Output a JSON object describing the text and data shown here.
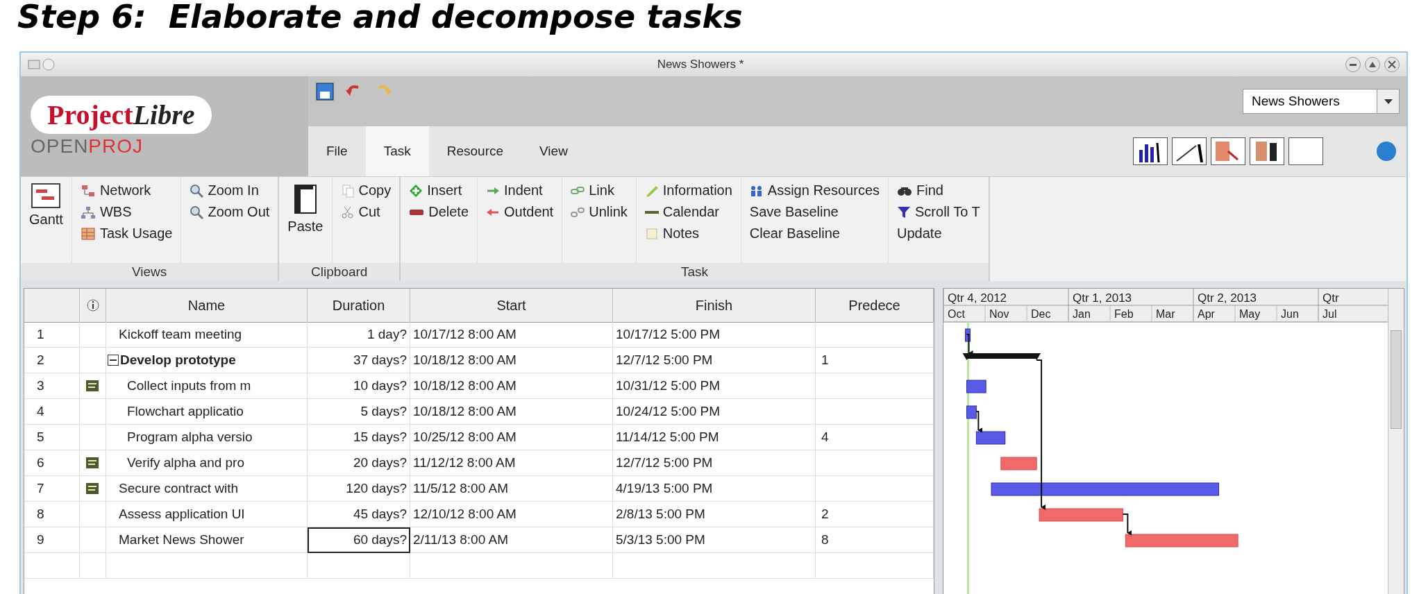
{
  "slide_title": "Step 6:  Elaborate and decompose tasks",
  "window": {
    "title": "News Showers *"
  },
  "logo": {
    "name_a": "Project",
    "name_b": "Libre",
    "sub_a": "OPEN",
    "sub_b": "PROJ"
  },
  "project_selector": {
    "value": "News Showers"
  },
  "menu_tabs": [
    {
      "label": "File",
      "selected": false
    },
    {
      "label": "Task",
      "selected": true
    },
    {
      "label": "Resource",
      "selected": false
    },
    {
      "label": "View",
      "selected": false
    }
  ],
  "ribbon_groups": [
    {
      "label": "Views",
      "sections": [
        [
          {
            "label": "Gantt",
            "kind": "large"
          }
        ],
        [
          {
            "label": "Network",
            "kind": "small"
          },
          {
            "label": "WBS",
            "kind": "small"
          },
          {
            "label": "Task Usage",
            "kind": "small"
          }
        ],
        [
          {
            "label": "Zoom In",
            "kind": "small"
          },
          {
            "label": "Zoom Out",
            "kind": "small"
          }
        ]
      ]
    },
    {
      "label": "Clipboard",
      "sections": [
        [
          {
            "label": "Paste",
            "kind": "large"
          }
        ],
        [
          {
            "label": "Copy",
            "kind": "small"
          },
          {
            "label": "Cut",
            "kind": "small"
          }
        ]
      ]
    },
    {
      "label": "Task",
      "sections": [
        [
          {
            "label": "Insert",
            "kind": "small"
          },
          {
            "label": "Delete",
            "kind": "small"
          }
        ],
        [
          {
            "label": "Indent",
            "kind": "small"
          },
          {
            "label": "Outdent",
            "kind": "small"
          }
        ],
        [
          {
            "label": "Link",
            "kind": "small"
          },
          {
            "label": "Unlink",
            "kind": "small"
          }
        ],
        [
          {
            "label": "Information",
            "kind": "small"
          },
          {
            "label": "Calendar",
            "kind": "small"
          },
          {
            "label": "Notes",
            "kind": "small"
          }
        ],
        [
          {
            "label": "Assign Resources",
            "kind": "small"
          },
          {
            "label": "Save Baseline",
            "kind": "small"
          },
          {
            "label": "Clear Baseline",
            "kind": "small"
          }
        ],
        [
          {
            "label": "Find",
            "kind": "small"
          },
          {
            "label": "Scroll To T",
            "kind": "small"
          },
          {
            "label": "Update",
            "kind": "small"
          }
        ]
      ]
    }
  ],
  "table": {
    "columns": [
      "Name",
      "Duration",
      "Start",
      "Finish",
      "Predece"
    ],
    "tasks": [
      {
        "row": "1",
        "name": "Kickoff team meeting",
        "duration": "1 day?",
        "start": "10/17/12 8:00 AM",
        "finish": "10/17/12 5:00 PM",
        "note": false,
        "critical": false,
        "duration_selected": false
      },
      {
        "row": "2",
        "name": "Develop prototype",
        "duration": "37 days?",
        "start": "10/18/12 8:00 AM",
        "finish": "12/7/12 5:00 PM",
        "predecessors": "1",
        "note": false,
        "duration_selected": false,
        "expanded": true,
        "children": [
          {
            "row": "3",
            "name": "Collect inputs from m",
            "duration": "10 days?",
            "start": "10/18/12 8:00 AM",
            "finish": "10/31/12 5:00 PM",
            "note": true,
            "critical": false,
            "duration_selected": false
          },
          {
            "row": "4",
            "name": "Flowchart applicatio",
            "duration": "5 days?",
            "start": "10/18/12 8:00 AM",
            "finish": "10/24/12 5:00 PM",
            "note": false,
            "critical": false,
            "duration_selected": false
          },
          {
            "row": "5",
            "name": "Program alpha versio",
            "duration": "15 days?",
            "start": "10/25/12 8:00 AM",
            "finish": "11/14/12 5:00 PM",
            "predecessors": "4",
            "note": false,
            "critical": false,
            "duration_selected": false
          },
          {
            "row": "6",
            "name": "Verify alpha and pro",
            "duration": "20 days?",
            "start": "11/12/12 8:00 AM",
            "finish": "12/7/12 5:00 PM",
            "note": true,
            "critical": true,
            "duration_selected": false
          }
        ]
      },
      {
        "row": "7",
        "name": "Secure contract with",
        "duration": "120 days?",
        "start": "11/5/12 8:00 AM",
        "finish": "4/19/13 5:00 PM",
        "note": true,
        "critical": false,
        "duration_selected": false
      },
      {
        "row": "8",
        "name": "Assess application UI",
        "duration": "45 days?",
        "start": "12/10/12 8:00 AM",
        "finish": "2/8/13 5:00 PM",
        "predecessors": "2",
        "note": false,
        "critical": true,
        "duration_selected": false
      },
      {
        "row": "9",
        "name": "Market News Shower",
        "duration": "60 days?",
        "start": "2/11/13 8:00 AM",
        "finish": "5/3/13 5:00 PM",
        "predecessors": "8",
        "note": false,
        "critical": true,
        "duration_selected": true
      }
    ]
  },
  "gantt": {
    "quarters": [
      "Qtr 4, 2012",
      "Qtr 1, 2013",
      "Qtr 2, 2013",
      "Qtr"
    ],
    "months": [
      "Oct",
      "Nov",
      "Dec",
      "Jan",
      "Feb",
      "Mar",
      "Apr",
      "May",
      "Jun",
      "Jul"
    ]
  }
}
